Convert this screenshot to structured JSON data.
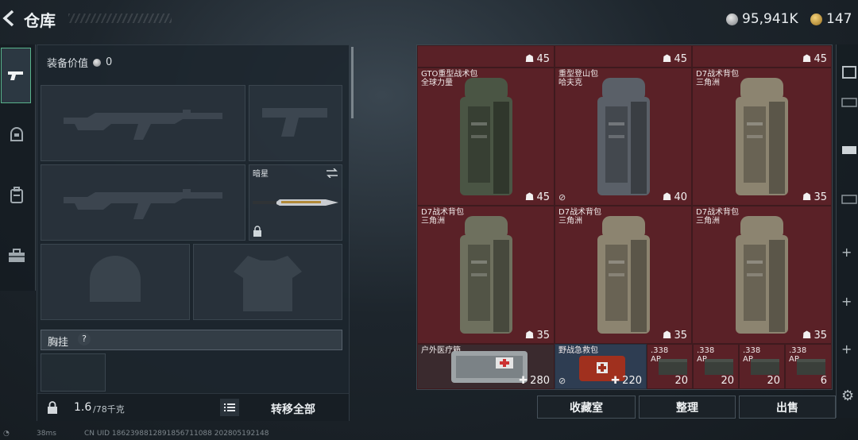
{
  "header": {
    "title": "仓库",
    "currencies": [
      {
        "amount": "95,941K",
        "icon": "silver-coin-icon"
      },
      {
        "amount": "147",
        "icon": "gold-coin-icon"
      }
    ]
  },
  "equipment": {
    "value_label": "装备价值",
    "value": "0",
    "melee_slot": {
      "label": "暗星"
    },
    "vest_label": "胸挂",
    "vest_help": "?",
    "weight": "1.6",
    "weight_max": "/78千克",
    "transfer_all_label": "转移全部"
  },
  "inventory": {
    "top_row_caps": [
      "45",
      "45",
      "45"
    ],
    "backpacks": [
      {
        "name_line1": "GTO重型战术包",
        "name_line2": "全球力量",
        "capacity": "45",
        "tint": "#4a5544",
        "no_export": false
      },
      {
        "name_line1": "重型登山包",
        "name_line2": "哈夫克",
        "capacity": "40",
        "tint": "#5a6068",
        "no_export": true
      },
      {
        "name_line1": "D7战术背包",
        "name_line2": "三角洲",
        "capacity": "35",
        "tint": "#8c8470",
        "no_export": false
      },
      {
        "name_line1": "D7战术背包",
        "name_line2": "三角洲",
        "capacity": "35",
        "tint": "#6e705e",
        "no_export": false
      },
      {
        "name_line1": "D7战术背包",
        "name_line2": "三角洲",
        "capacity": "35",
        "tint": "#8c8470",
        "no_export": false
      },
      {
        "name_line1": "D7战术背包",
        "name_line2": "三角洲",
        "capacity": "35",
        "tint": "#8c8470",
        "no_export": false
      }
    ],
    "medkits": [
      {
        "name": "户外医疗箱",
        "count": "280"
      },
      {
        "name": "野战急救包",
        "count": "220"
      }
    ],
    "ammo": [
      {
        "name_line1": ".338",
        "name_line2": "AP",
        "count": "20"
      },
      {
        "name_line1": ".338",
        "name_line2": "AP",
        "count": "20"
      },
      {
        "name_line1": ".338",
        "name_line2": "AP",
        "count": "20"
      },
      {
        "name_line1": ".338",
        "name_line2": "AP",
        "count": "6"
      }
    ]
  },
  "actions": {
    "collection": "收藏室",
    "sort": "整理",
    "sell": "出售"
  },
  "status": {
    "ping": "38ms",
    "uid": "CN UID 1862398812891856711088 202805192148"
  },
  "colors": {
    "rarity_red": "#5a2127",
    "rarity_blue": "#2e3d52",
    "accent_green": "#58b38c"
  }
}
